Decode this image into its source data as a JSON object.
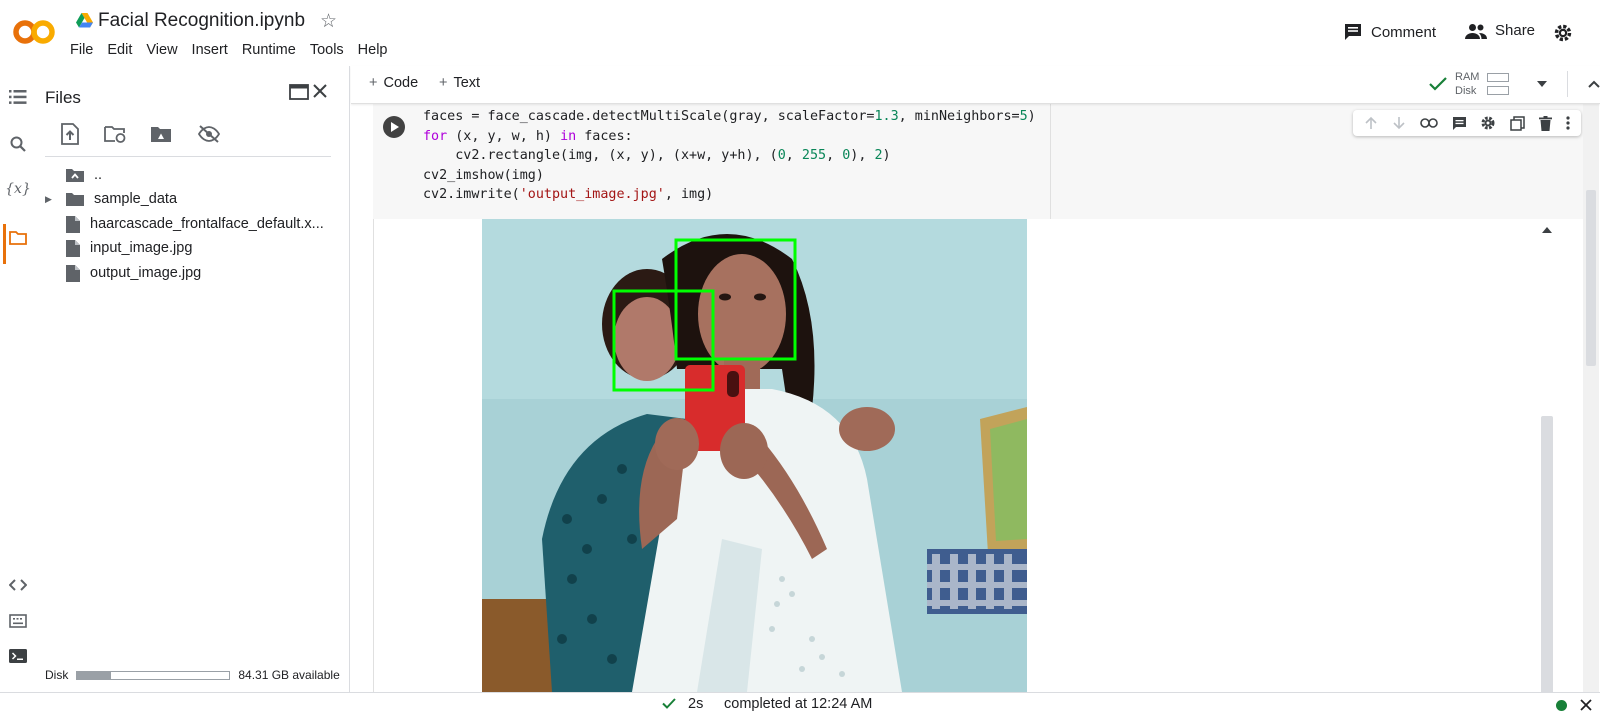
{
  "app": {
    "logo_text": "CO",
    "title": "Facial Recognition.ipynb",
    "menu": [
      "File",
      "Edit",
      "View",
      "Insert",
      "Runtime",
      "Tools",
      "Help"
    ],
    "comment_label": "Comment",
    "share_label": "Share"
  },
  "sidebar": {
    "title": "Files",
    "items": [
      {
        "label": "..",
        "icon": "folder-up-icon"
      },
      {
        "label": "sample_data",
        "icon": "folder-icon"
      },
      {
        "label": "haarcascade_frontalface_default.x...",
        "icon": "file-icon"
      },
      {
        "label": "input_image.jpg",
        "icon": "file-icon"
      },
      {
        "label": "output_image.jpg",
        "icon": "file-icon"
      }
    ],
    "disk_label": "Disk",
    "disk_available": "84.31 GB available",
    "disk_used_fraction": 0.22
  },
  "toolbar": {
    "add_code": "Code",
    "add_text": "Text",
    "ram_label": "RAM",
    "disk_label": "Disk"
  },
  "cell": {
    "lines": [
      "faces = face_cascade.detectMultiScale(gray, scaleFactor=1.3, minNeighbors=5)",
      "for (x, y, w, h) in faces:",
      "    cv2.rectangle(img, (x, y), (x+w, y+h), (0, 255, 0), 2)",
      "cv2_imshow(img)",
      "cv2.imwrite('output_image.jpg', img)"
    ]
  },
  "status": {
    "duration": "2s",
    "message": "completed at 12:24 AM"
  },
  "colors": {
    "accent": "#e8710a",
    "logo_yellow": "#f9ab00",
    "detection_box": "#00ff00",
    "success": "#188038"
  }
}
